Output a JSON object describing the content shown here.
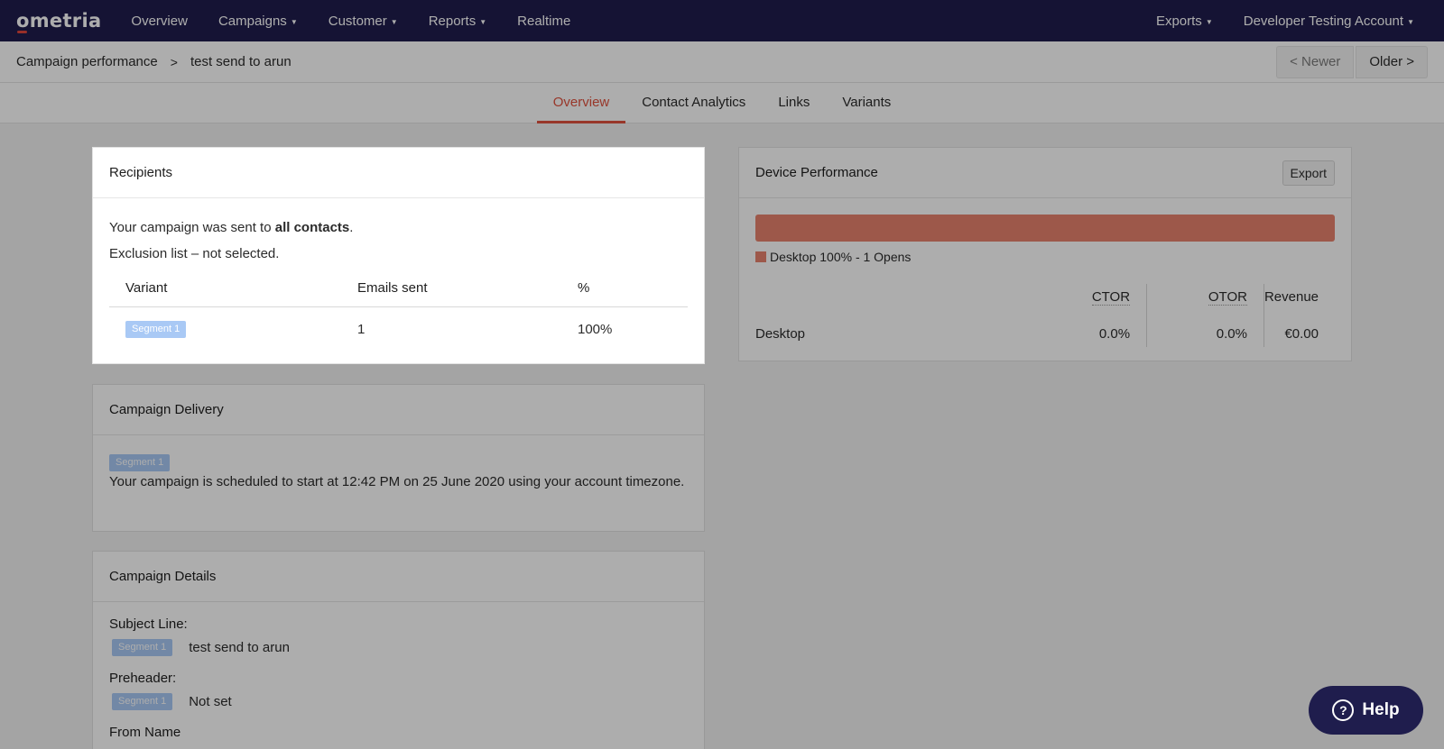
{
  "nav": {
    "logo": "ometria",
    "items": [
      "Overview",
      "Campaigns",
      "Customer",
      "Reports",
      "Realtime"
    ],
    "right": [
      "Exports",
      "Developer Testing Account"
    ]
  },
  "breadcrumb": {
    "parent": "Campaign performance",
    "separator": ">",
    "current": "test send to arun",
    "newer": "< Newer",
    "older": "Older >"
  },
  "tabs": [
    "Overview",
    "Contact Analytics",
    "Links",
    "Variants"
  ],
  "recipients": {
    "title": "Recipients",
    "sent_prefix": "Your campaign was sent to ",
    "sent_target": "all contacts",
    "sent_suffix": ".",
    "exclusion": "Exclusion list – not selected.",
    "columns": [
      "Variant",
      "Emails sent",
      "%"
    ],
    "rows": [
      {
        "variant": "Segment 1",
        "emails_sent": "1",
        "percent": "100%"
      }
    ]
  },
  "device": {
    "title": "Device Performance",
    "export": "Export",
    "legend": "Desktop 100% - 1 Opens",
    "desktop_share": 1.0,
    "bar_color": "#e8826e",
    "columns": [
      "CTOR",
      "OTOR",
      "Revenue"
    ],
    "rows": [
      {
        "device": "Desktop",
        "ctor": "0.0%",
        "otor": "0.0%",
        "revenue": "€0.00"
      }
    ]
  },
  "delivery": {
    "title": "Campaign Delivery",
    "badge": "Segment 1",
    "text": "Your campaign is scheduled to start at 12:42 PM on 25 June 2020 using your account timezone."
  },
  "details": {
    "title": "Campaign Details",
    "subject_label": "Subject Line:",
    "subject_badge": "Segment 1",
    "subject_value": "test send to arun",
    "preheader_label": "Preheader:",
    "preheader_badge": "Segment 1",
    "preheader_value": "Not set",
    "from_label": "From Name"
  },
  "help": {
    "label": "Help"
  },
  "colors": {
    "nav_bg": "#1f1d4d",
    "accent": "#e0523f",
    "badge": "#a9c9f5"
  }
}
